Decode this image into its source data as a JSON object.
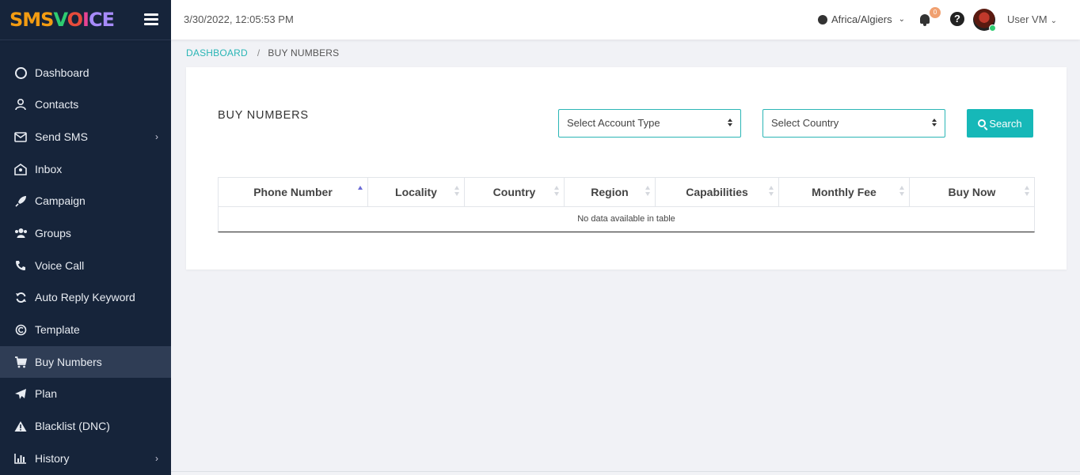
{
  "header": {
    "logo": [
      "SMS",
      "V",
      "O",
      "I",
      "CE"
    ],
    "datetime": "3/30/2022, 12:05:53 PM",
    "timezone": "Africa/Algiers",
    "notification_count": "0",
    "help": "?",
    "user_name": "User VM"
  },
  "sidebar": {
    "items": [
      {
        "label": "Dashboard",
        "icon": "dashboard-gauge-icon"
      },
      {
        "label": "Contacts",
        "icon": "user-icon"
      },
      {
        "label": "Send SMS",
        "icon": "envelope-icon"
      },
      {
        "label": "Inbox",
        "icon": "inbox-icon"
      },
      {
        "label": "Campaign",
        "icon": "rocket-icon"
      },
      {
        "label": "Groups",
        "icon": "users-icon"
      },
      {
        "label": "Voice Call",
        "icon": "phone-icon"
      },
      {
        "label": "Auto Reply Keyword",
        "icon": "refresh-icon"
      },
      {
        "label": "Template",
        "icon": "template-icon"
      },
      {
        "label": "Buy Numbers",
        "icon": "cart-icon"
      },
      {
        "label": "Plan",
        "icon": "paper-plane-icon"
      },
      {
        "label": "Blacklist (DNC)",
        "icon": "warning-icon"
      },
      {
        "label": "History",
        "icon": "bar-chart-icon"
      }
    ]
  },
  "breadcrumb": {
    "home": "DASHBOARD",
    "separator": "/",
    "current": "BUY NUMBERS"
  },
  "main": {
    "title": "BUY NUMBERS",
    "account_type_select": "Select Account Type",
    "country_select": "Select Country",
    "search_label": "Search",
    "table": {
      "columns": [
        "Phone Number",
        "Locality",
        "Country",
        "Region",
        "Capabilities",
        "Monthly Fee",
        "Buy Now"
      ],
      "empty_message": "No data available in table"
    }
  },
  "colors": {
    "sidebar_bg": "#16243a",
    "sidebar_active": "#2f3d55",
    "accent": "#16b8b8",
    "page_bg": "#f1f2f6"
  }
}
